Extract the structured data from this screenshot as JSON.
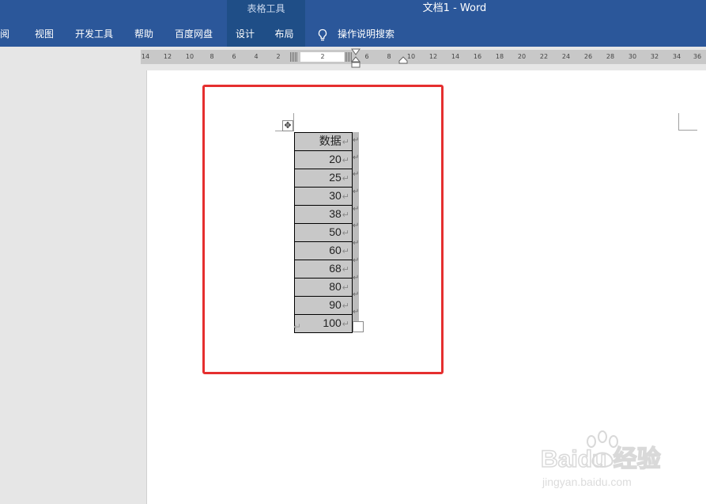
{
  "window": {
    "title": "文档1  -  Word",
    "context_group": "表格工具"
  },
  "ribbon": {
    "tabs": [
      {
        "label": "审阅"
      },
      {
        "label": "视图"
      },
      {
        "label": "开发工具"
      },
      {
        "label": "帮助"
      },
      {
        "label": "百度网盘"
      },
      {
        "label": "设计"
      },
      {
        "label": "布局"
      }
    ],
    "search_label": "操作说明搜索",
    "search_icon": "lightbulb-icon"
  },
  "ruler": {
    "ticks": [
      "14",
      "12",
      "10",
      "8",
      "6",
      "4",
      "2",
      "2",
      "6",
      "8",
      "10",
      "12",
      "14",
      "16",
      "18",
      "20",
      "22",
      "24",
      "26",
      "28",
      "30",
      "32",
      "34",
      "36"
    ]
  },
  "table": {
    "header": "数据",
    "rows": [
      "20",
      "25",
      "30",
      "38",
      "50",
      "60",
      "68",
      "80",
      "90",
      "100"
    ],
    "paragraph_mark": "↵"
  },
  "colors": {
    "titlebar": "#2b579a",
    "context_tab": "#1f4e87",
    "highlight_box": "#e52f2f",
    "cell_shading": "#c8c8c8"
  },
  "watermark": {
    "brand": "Baidu 经验",
    "url": "jingyan.baidu.com"
  }
}
